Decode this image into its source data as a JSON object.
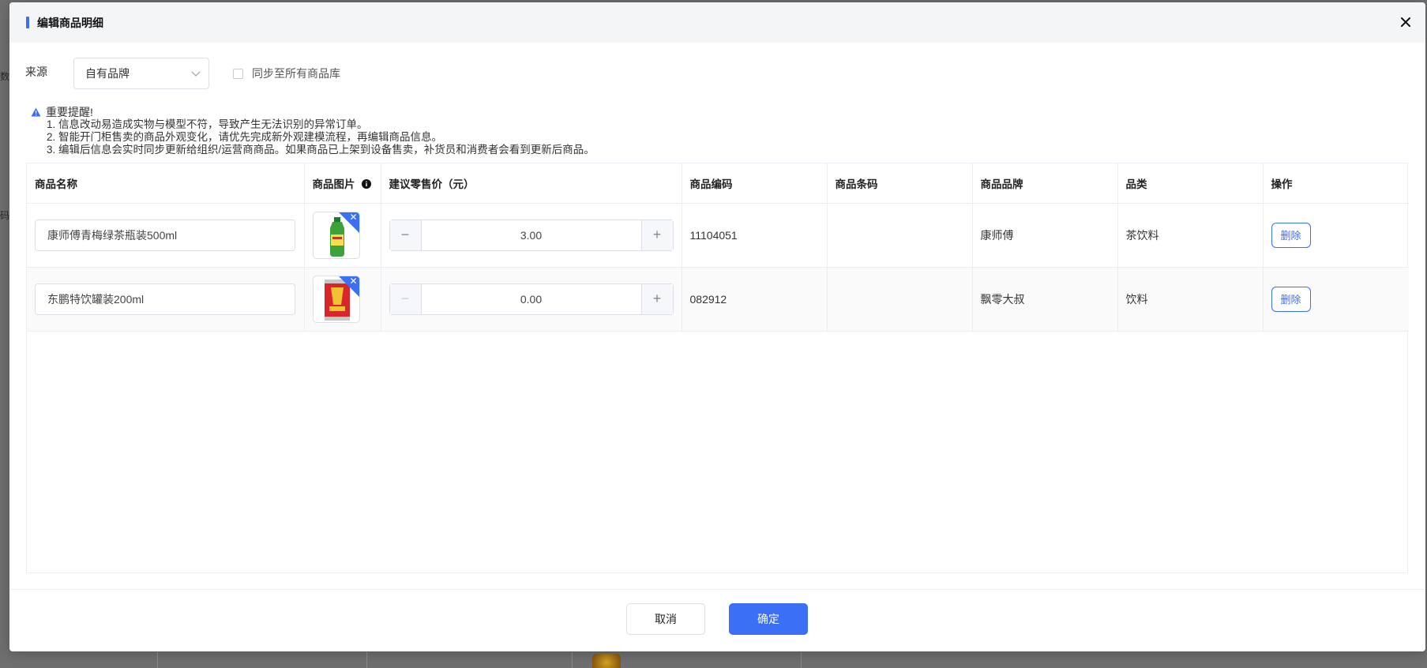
{
  "modal": {
    "title": "编辑商品明细"
  },
  "source": {
    "label": "来源",
    "selected": "自有品牌",
    "sync_label": "同步至所有商品库",
    "sync_checked": false
  },
  "notice": {
    "heading": "重要提醒!",
    "items": [
      "1. 信息改动易造成实物与模型不符，导致产生无法识别的异常订单。",
      "2. 智能开门柜售卖的商品外观变化，请优先完成新外观建模流程，再编辑商品信息。",
      "3. 编辑后信息会实时同步更新给组织/运营商商品。如果商品已上架到设备售卖，补货员和消费者会看到更新后商品。"
    ]
  },
  "table": {
    "columns": [
      "商品名称",
      "商品图片",
      "建议零售价（元）",
      "商品编码",
      "商品条码",
      "商品品牌",
      "品类",
      "操作"
    ],
    "rows": [
      {
        "name": "康师傅青梅绿茶瓶装500ml",
        "image": "green-tea-bottle",
        "price": "3.00",
        "code": "11104051",
        "barcode": "",
        "brand": "康师傅",
        "category": "茶饮料",
        "action": "删除"
      },
      {
        "name": "东鹏特饮罐装200ml",
        "image": "energy-drink-can",
        "price": "0.00",
        "code": "082912",
        "barcode": "",
        "brand": "飘零大叔",
        "category": "饮料",
        "action": "删除"
      }
    ]
  },
  "footer": {
    "cancel": "取消",
    "confirm": "确定"
  },
  "background": {
    "left_text_1": "数",
    "left_text_2": "码"
  },
  "colors": {
    "accent": "#3b6ff5",
    "header_bg": "#f4f5f7",
    "overlay": "#6f6f6f"
  }
}
